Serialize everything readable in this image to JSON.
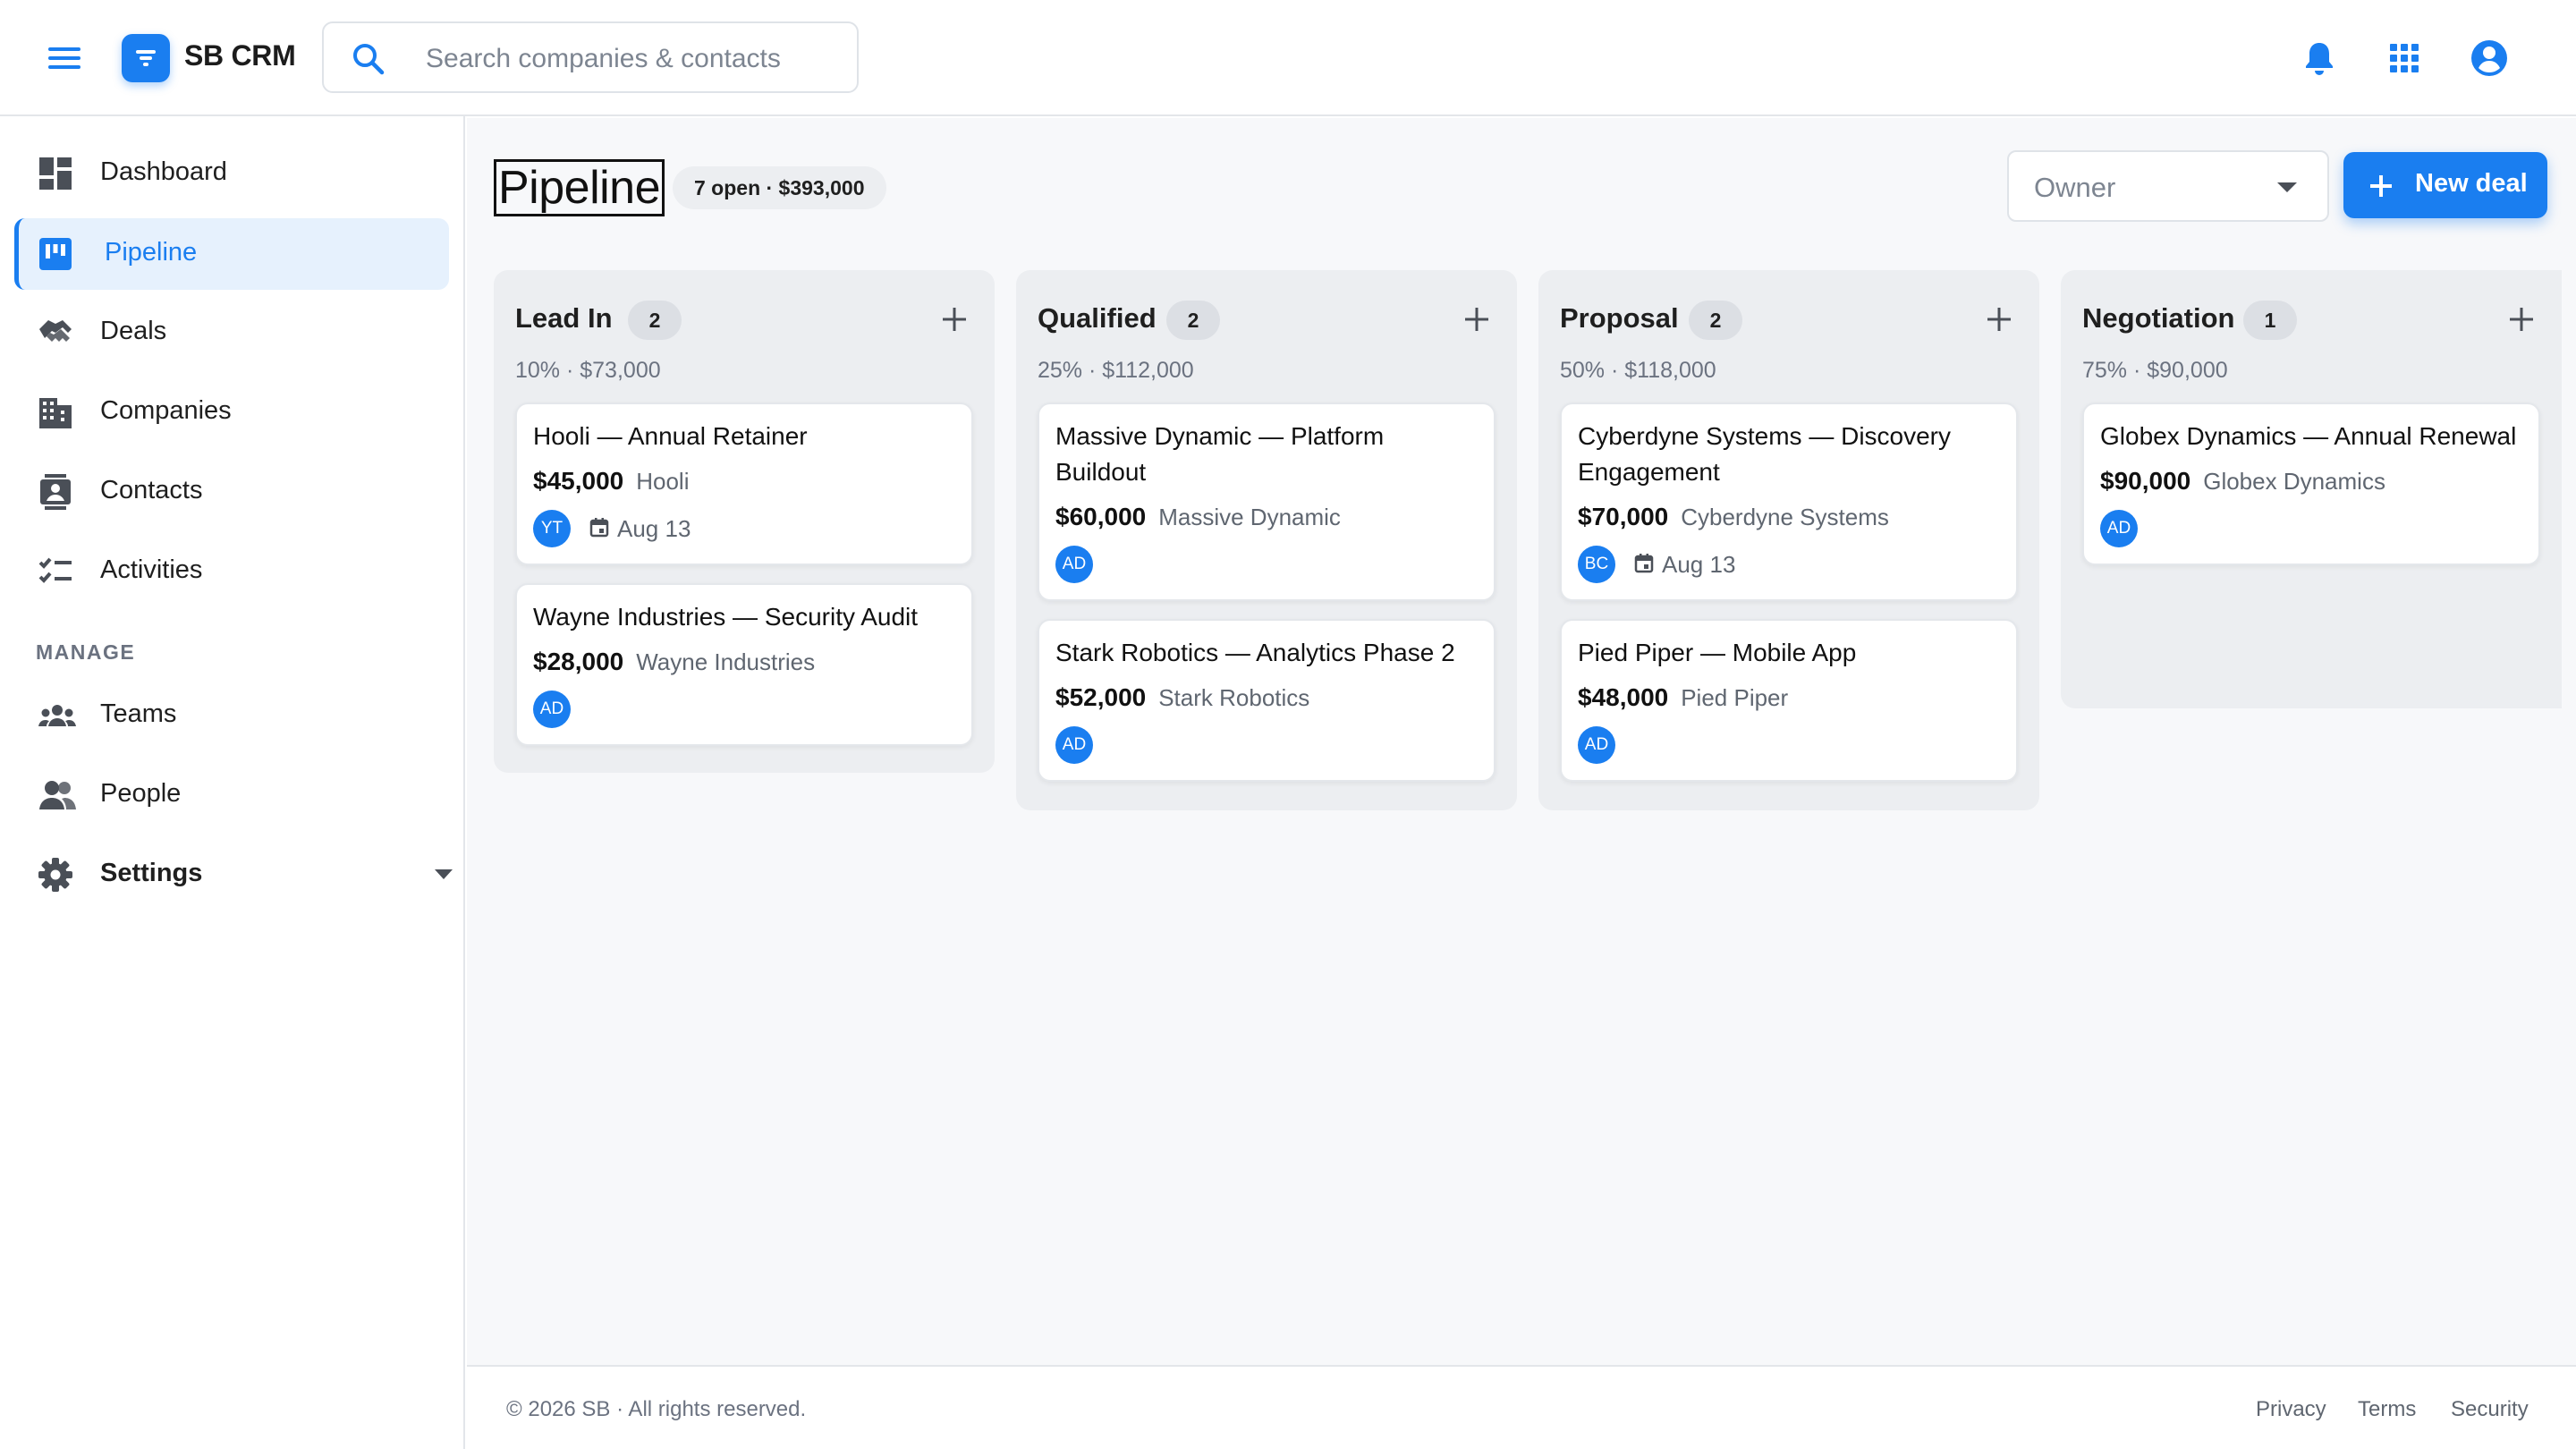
{
  "app": {
    "brand": "SB CRM"
  },
  "search": {
    "placeholder": "Search companies & contacts"
  },
  "topbar": {
    "icons": [
      "menu-icon",
      "bell-icon",
      "apps-grid-icon",
      "account-circle-icon"
    ]
  },
  "sidebar": {
    "items": [
      {
        "label": "Dashboard",
        "icon": "dashboard-icon"
      },
      {
        "label": "Pipeline",
        "icon": "pipeline-board-icon",
        "active": true
      },
      {
        "label": "Deals",
        "icon": "handshake-icon"
      },
      {
        "label": "Companies",
        "icon": "building-icon"
      },
      {
        "label": "Contacts",
        "icon": "contact-card-icon"
      },
      {
        "label": "Activities",
        "icon": "checklist-icon"
      }
    ],
    "section_label": "MANAGE",
    "manage_items": [
      {
        "label": "Teams",
        "icon": "group-icon"
      },
      {
        "label": "People",
        "icon": "people-icon"
      },
      {
        "label": "Settings",
        "icon": "gear-icon",
        "expandable": true
      }
    ]
  },
  "page": {
    "title": "Pipeline",
    "summary": "7 open · $393,000",
    "owner_filter": {
      "label": "Owner"
    },
    "new_deal_label": "New deal"
  },
  "columns": [
    {
      "name": "Lead In",
      "count": "2",
      "meta": "10% · $73,000",
      "cards": [
        {
          "title": "Hooli — Annual Retainer",
          "value": "$45,000",
          "company": "Hooli",
          "avatar": "YT",
          "due": "Aug 13"
        },
        {
          "title": "Wayne Industries — Security Audit",
          "value": "$28,000",
          "company": "Wayne Industries",
          "avatar": "AD"
        }
      ]
    },
    {
      "name": "Qualified",
      "count": "2",
      "meta": "25% · $112,000",
      "cards": [
        {
          "title": "Massive Dynamic — Platform Buildout",
          "value": "$60,000",
          "company": "Massive Dynamic",
          "avatar": "AD"
        },
        {
          "title": "Stark Robotics — Analytics Phase 2",
          "value": "$52,000",
          "company": "Stark Robotics",
          "avatar": "AD"
        }
      ]
    },
    {
      "name": "Proposal",
      "count": "2",
      "meta": "50% · $118,000",
      "cards": [
        {
          "title": "Cyberdyne Systems — Discovery Engagement",
          "value": "$70,000",
          "company": "Cyberdyne Systems",
          "avatar": "BC",
          "due": "Aug 13"
        },
        {
          "title": "Pied Piper — Mobile App",
          "value": "$48,000",
          "company": "Pied Piper",
          "avatar": "AD"
        }
      ]
    },
    {
      "name": "Negotiation",
      "count": "1",
      "meta": "75% · $90,000",
      "cards": [
        {
          "title": "Globex Dynamics — Annual Renewal",
          "value": "$90,000",
          "company": "Globex Dynamics",
          "avatar": "AD"
        }
      ]
    }
  ],
  "footer": {
    "copyright": "© 2026 SB · All rights reserved.",
    "links": [
      "Privacy",
      "Terms",
      "Security"
    ]
  },
  "colors": {
    "accent": "#1a7ef0",
    "column_bg": "#eceef1",
    "active_nav_bg": "#e6f1fd"
  }
}
